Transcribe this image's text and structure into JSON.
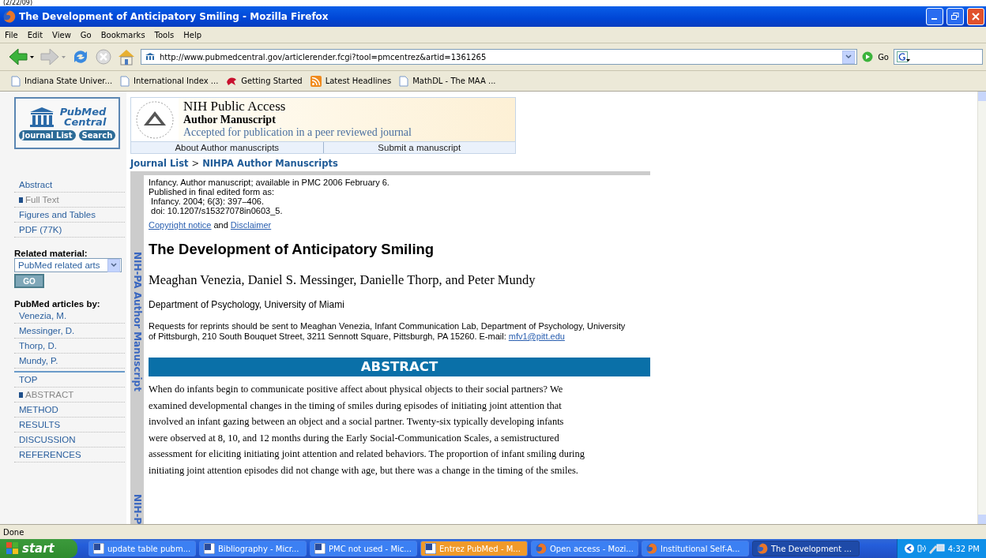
{
  "caption": "(2/22/09)",
  "window": {
    "title": "The Development of Anticipatory Smiling - Mozilla Firefox"
  },
  "menu": [
    "File",
    "Edit",
    "View",
    "Go",
    "Bookmarks",
    "Tools",
    "Help"
  ],
  "address": {
    "value": "http://www.pubmedcentral.gov/articlerender.fcgi?tool=pmcentrez&artid=1361265"
  },
  "go_label": "Go",
  "bookmarks": [
    {
      "kind": "page",
      "label": "Indiana State Univer..."
    },
    {
      "kind": "page",
      "label": "International Index ..."
    },
    {
      "kind": "start",
      "label": "Getting Started"
    },
    {
      "kind": "feed",
      "label": "Latest Headlines"
    },
    {
      "kind": "page",
      "label": "MathDL - The MAA ..."
    }
  ],
  "logo": {
    "line1": "PubMed",
    "line2": "Central",
    "buttons": [
      "Journal List",
      "Search"
    ]
  },
  "sidebar": {
    "items": [
      {
        "label": "Abstract",
        "selected": false
      },
      {
        "label": "Full Text",
        "selected": true
      },
      {
        "label": "Figures and Tables",
        "selected": false
      },
      {
        "label": "PDF (77K)",
        "selected": false
      }
    ],
    "related_label": "Related material:",
    "related_select": "PubMed related arts",
    "go_button": "GO",
    "articles_label": "PubMed articles by:",
    "authors": [
      "Venezia, M.",
      "Messinger, D.",
      "Thorp, D.",
      "Mundy, P."
    ],
    "sections": [
      {
        "label": "TOP",
        "selected": false
      },
      {
        "label": "ABSTRACT",
        "selected": true
      },
      {
        "label": "METHOD",
        "selected": false
      },
      {
        "label": "RESULTS",
        "selected": false
      },
      {
        "label": "DISCUSSION",
        "selected": false
      },
      {
        "label": "REFERENCES",
        "selected": false
      }
    ]
  },
  "banner": {
    "title": "NIH Public Access",
    "subtitle": "Author Manuscript",
    "note": "Accepted for publication in a peer reviewed journal",
    "tabs": [
      "About Author manuscripts",
      "Submit a manuscript"
    ]
  },
  "breadcrumb": [
    "Journal List",
    "NIHPA Author Manuscripts"
  ],
  "breadcrumb_sep": ">",
  "side_stamps": [
    "NIH-PA Author Manuscript",
    "NIH-P"
  ],
  "citation": [
    "Infancy. Author manuscript; available in PMC 2006 February 6.",
    "Published in final edited form as:",
    " Infancy. 2004; 6(3): 397–406.",
    " doi: 10.1207/s15327078in0603_5."
  ],
  "notice": {
    "link1": "Copyright notice",
    "middle": "and",
    "link2": "Disclaimer"
  },
  "article": {
    "title": "The Development of Anticipatory Smiling",
    "authors": "Meaghan Venezia, Daniel S. Messinger, Danielle Thorp, and Peter Mundy",
    "affiliation": "Department of Psychology, University of Miami",
    "reprints": "Requests for reprints should be sent to Meaghan Venezia, Infant Communication Lab, Department of Psychology, University of Pittsburgh, 210 South Bouquet Street, 3211 Sennott Square, Pittsburgh, PA 15260. E-mail:",
    "email": "mfv1@pitt.edu"
  },
  "abstract": {
    "heading": "ABSTRACT",
    "lines": [
      "When do infants begin to communicate positive affect about physical objects to their social partners? We",
      "examined developmental changes in the timing of smiles during episodes of initiating joint attention that",
      "involved an infant gazing between an object and a social partner. Twenty-six typically developing infants",
      "were observed at 8, 10, and 12 months during the Early Social-Communication Scales, a semistructured",
      "assessment for eliciting initiating joint attention and related behaviors. The proportion of infant smiling during",
      "initiating joint attention episodes did not change with age, but there was a change in the timing of the smiles."
    ]
  },
  "status_bar": "Done",
  "taskbar": {
    "start": "start",
    "items": [
      {
        "label": "update table pubm...",
        "kind": "word",
        "selected": false,
        "flashing": false
      },
      {
        "label": "Bibliography - Micr...",
        "kind": "word",
        "selected": false,
        "flashing": false
      },
      {
        "label": "PMC not used - Mic...",
        "kind": "word",
        "selected": false,
        "flashing": false
      },
      {
        "label": "Entrez PubMed - M...",
        "kind": "word",
        "selected": false,
        "flashing": true
      },
      {
        "label": "Open access - Mozi...",
        "kind": "firefox",
        "selected": false,
        "flashing": false
      },
      {
        "label": "Institutional Self-A...",
        "kind": "firefox",
        "selected": false,
        "flashing": false
      },
      {
        "label": "The Development ...",
        "kind": "firefox",
        "selected": true,
        "flashing": false
      }
    ],
    "clock": "4:32 PM"
  }
}
